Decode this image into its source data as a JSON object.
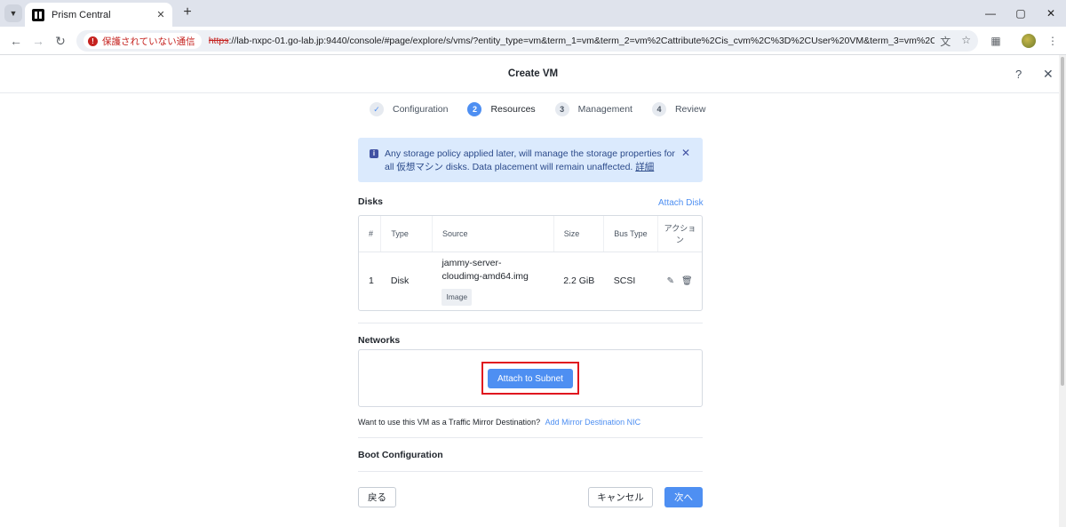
{
  "browser": {
    "tab_title": "Prism Central",
    "tab_close": "✕",
    "new_tab": "+",
    "security_label": "保護されていない通信",
    "url_scheme": "https",
    "url_rest": "://lab-nxpc-01.go-lab.jp:9440/console/#page/explore/s/vms/?entity_type=vm&term_1=vm&term_2=vm%2Cattribute%2Cis_cvm%2C%3D%2CUser%20VM&term_3=vm%2Cperspective%..."
  },
  "modal": {
    "title": "Create VM",
    "help": "?",
    "close": "✕"
  },
  "stepper": {
    "steps": [
      {
        "number": "✓",
        "label": "Configuration"
      },
      {
        "number": "2",
        "label": "Resources"
      },
      {
        "number": "3",
        "label": "Management"
      },
      {
        "number": "4",
        "label": "Review"
      }
    ]
  },
  "alert": {
    "text": "Any storage policy applied later, will manage the storage properties for all 仮想マシン disks. Data placement will remain unaffected.",
    "link": "詳細"
  },
  "disks": {
    "title": "Disks",
    "attach_label": "Attach Disk",
    "columns": [
      "#",
      "Type",
      "Source",
      "Size",
      "Bus Type",
      "アクション"
    ],
    "rows": [
      {
        "num": "1",
        "type": "Disk",
        "source": "jammy-server-cloudimg-amd64.img",
        "source_badge": "Image",
        "size": "2.2 GiB",
        "bus": "SCSI"
      }
    ]
  },
  "networks": {
    "title": "Networks",
    "attach_label": "Attach to Subnet",
    "mirror_question": "Want to use this VM as a Traffic Mirror Destination?",
    "mirror_link": "Add Mirror Destination NIC"
  },
  "boot": {
    "title": "Boot Configuration"
  },
  "footer": {
    "back_label": "戻る",
    "cancel_label": "キャンセル",
    "next_label": "次へ"
  }
}
